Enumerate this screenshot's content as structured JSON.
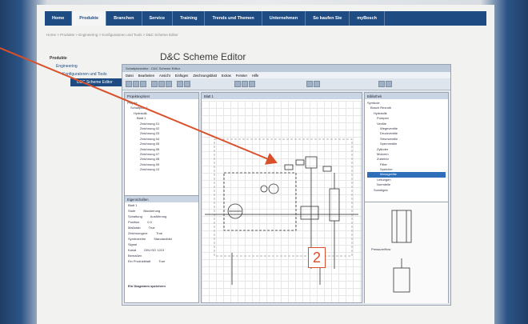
{
  "nav": {
    "items": [
      "Home",
      "Produkte",
      "Branchen",
      "Service",
      "Training",
      "Trends und Themen",
      "Unternehmen",
      "So kaufen Sie",
      "myBosch"
    ]
  },
  "breadcrumb": "Home > Produkte > Engineering > Konfiguratoren und Tools > D&C Scheme Editor",
  "left_nav": {
    "items": [
      "Produkte",
      "Engineering",
      "Konfiguratoren und Tools",
      "D&C Scheme Editor"
    ]
  },
  "page_title": "D&C Scheme Editor",
  "app": {
    "title": "Schaltplaneditor - D&C Scheme Editor",
    "menu": [
      "Datei",
      "Bearbeiten",
      "Ansicht",
      "Einfügen",
      "Zeichnungsblatt",
      "Extras",
      "Fenster",
      "Hilfe"
    ],
    "left_panel_title": "Projektexplorer",
    "tree": [
      "Projekt",
      "Schaltplan 1",
      "Hydraulik",
      "Blatt 1",
      "Zeichnung 01",
      "Zeichnung 02",
      "Zeichnung 03",
      "Zeichnung 04",
      "Zeichnung 05",
      "Zeichnung 06",
      "Zeichnung 07",
      "Zeichnung 08",
      "Zeichnung 09",
      "Zeichnung 10"
    ],
    "props_title": "Eigenschaften",
    "props": [
      {
        "k": "Blatt 1",
        "v": ""
      },
      {
        "k": "Stufe",
        "v": "Blockierung"
      },
      {
        "k": "Schaltung",
        "v": "Ausführung"
      },
      {
        "k": "Position",
        "v": "0.0"
      },
      {
        "k": "Maßstab",
        "v": "True"
      },
      {
        "k": "Zeichnungsnr.",
        "v": "True"
      },
      {
        "k": "Symbolreihe",
        "v": "Standardbild"
      },
      {
        "k": "Signal",
        "v": ""
      },
      {
        "k": "Kanal",
        "v": "DIN ISO 1219"
      },
      {
        "k": "Bemaßen",
        "v": ""
      },
      {
        "k": "Ein Produktblatt",
        "v": "True"
      }
    ],
    "props_footer": "Ein Diagramm speichern",
    "canvas_tab": "Blatt 1",
    "right_panel_title": "Bibliothek",
    "rtree": [
      "Symbole",
      "Bosch Rexroth",
      "Hydraulik",
      "Pumpen",
      "Ventile",
      "Wegeventile",
      "Druckventile",
      "Stromventile",
      "Sperrventile",
      "Zylinder",
      "Motoren",
      "Zubehör",
      "Filter",
      "Speicher",
      "Messgeräte",
      "Leitungen",
      "Normteile",
      "Sonstiges"
    ],
    "rtree_selected": 14,
    "preview_caption": "Pressure/flow"
  },
  "callout_number": "2",
  "colors": {
    "nav": "#1e4c82",
    "accent": "#d9502a"
  }
}
